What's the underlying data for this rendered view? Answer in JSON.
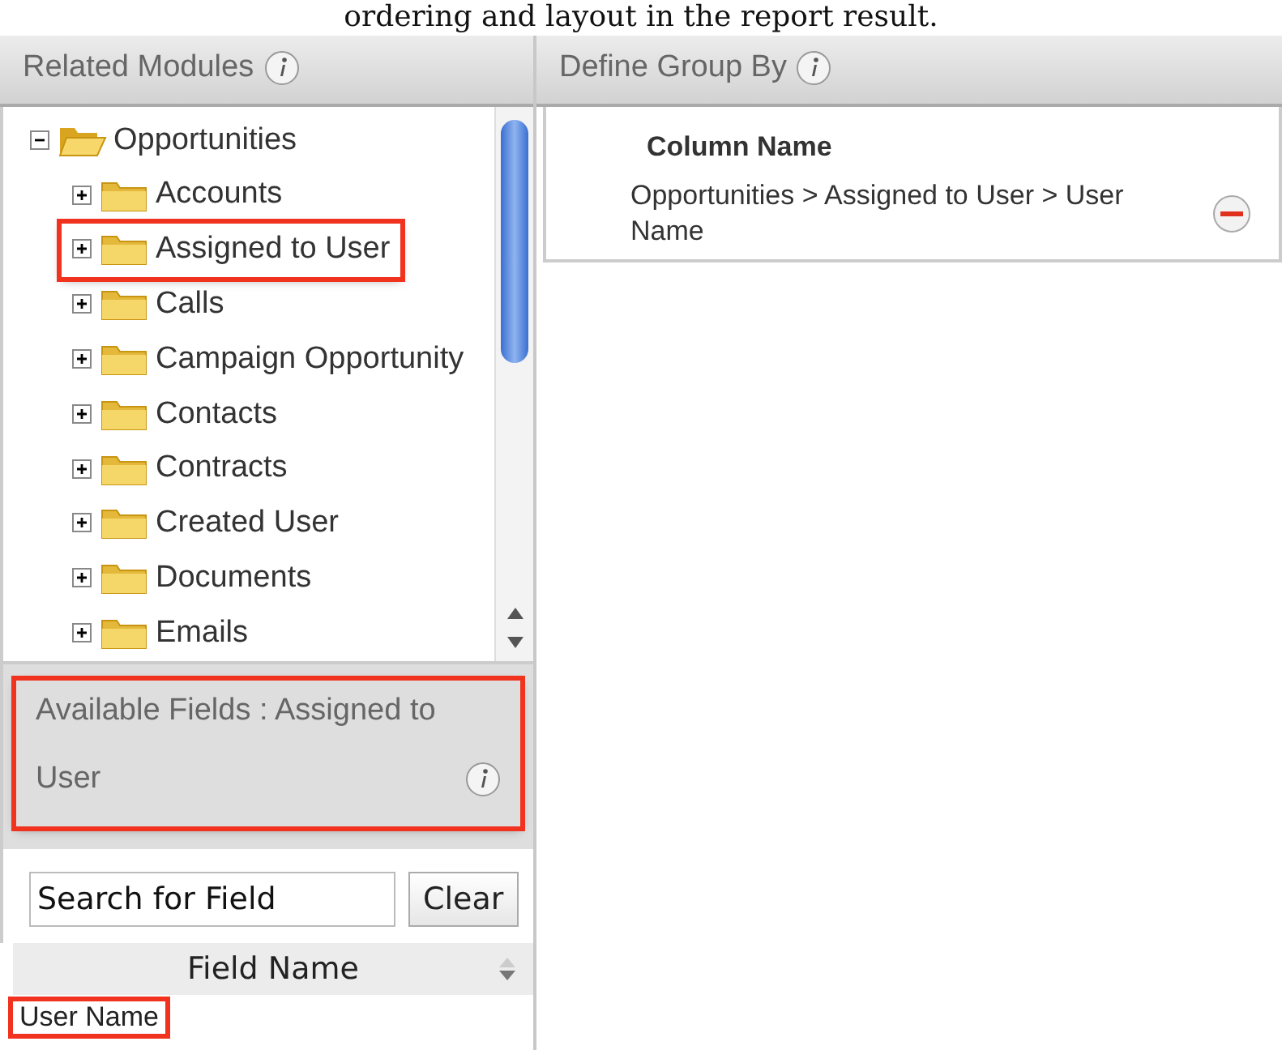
{
  "caption": "ordering and layout in the report result.",
  "related_modules": {
    "title": "Related Modules",
    "tree": [
      {
        "label": "Opportunities",
        "expanded": true,
        "highlighted": false,
        "children": [
          {
            "label": "Accounts",
            "expanded": false,
            "highlighted": false
          },
          {
            "label": "Assigned to User",
            "expanded": false,
            "highlighted": true
          },
          {
            "label": "Calls",
            "expanded": false,
            "highlighted": false
          },
          {
            "label": "Campaign Opportunity",
            "expanded": false,
            "highlighted": false
          },
          {
            "label": "Contacts",
            "expanded": false,
            "highlighted": false
          },
          {
            "label": "Contracts",
            "expanded": false,
            "highlighted": false
          },
          {
            "label": "Created User",
            "expanded": false,
            "highlighted": false
          },
          {
            "label": "Documents",
            "expanded": false,
            "highlighted": false
          },
          {
            "label": "Emails",
            "expanded": false,
            "highlighted": false
          }
        ]
      }
    ]
  },
  "available_fields": {
    "title": "Available Fields : Assigned to User",
    "highlighted": true,
    "search_value": "Search for Field",
    "clear_button": "Clear",
    "column": "Field Name",
    "rows": [
      {
        "label": "User Name",
        "highlighted": true
      }
    ]
  },
  "group_by": {
    "title": "Define Group By",
    "column": "Column Name",
    "rows": [
      {
        "label": "Opportunities > Assigned to User > User Name"
      }
    ]
  }
}
